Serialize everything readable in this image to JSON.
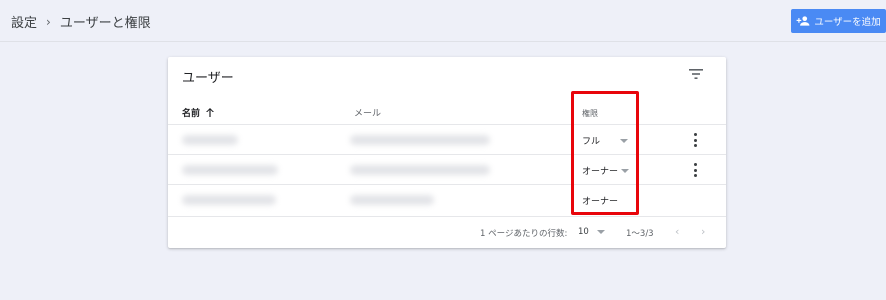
{
  "breadcrumb": {
    "root": "設定",
    "separator": "›",
    "current": "ユーザーと権限"
  },
  "actions": {
    "add_user_label": "ユーザーを追加",
    "add_user_icon": "person-add-icon"
  },
  "card": {
    "title": "ユーザー",
    "filter_icon": "filter-icon",
    "columns": {
      "name": "名前",
      "name_sort_icon": "arrow-up-icon",
      "mail": "メール",
      "permission": "権限"
    },
    "rows": [
      {
        "permission": "フル",
        "has_dropdown": true,
        "has_menu": true
      },
      {
        "permission": "オーナー",
        "has_dropdown": true,
        "has_menu": true
      },
      {
        "permission": "オーナー",
        "has_dropdown": false,
        "has_menu": false
      }
    ]
  },
  "pagination": {
    "rows_per_page_label": "1 ページあたりの行数:",
    "rows_per_page_value": "10",
    "range": "1〜3/3",
    "prev_icon": "chevron-left-icon",
    "next_icon": "chevron-right-icon"
  },
  "colors": {
    "accent": "#4a8af4",
    "highlight": "#e8050b",
    "background": "#eef0f8"
  }
}
